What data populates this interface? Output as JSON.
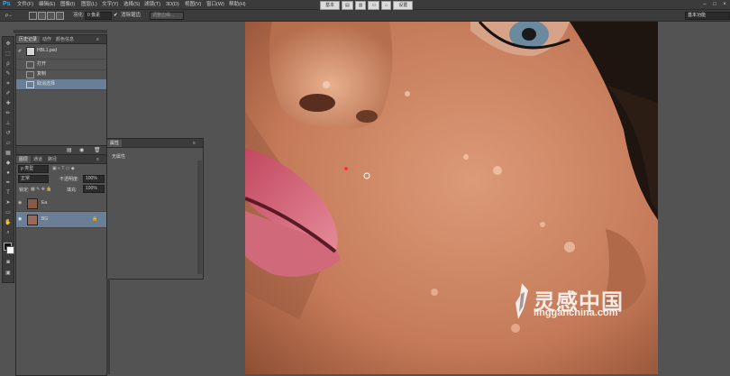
{
  "app": {
    "logo": "Ps"
  },
  "menu": [
    "文件(F)",
    "编辑(E)",
    "图像(I)",
    "图层(L)",
    "文字(Y)",
    "选择(S)",
    "滤镜(T)",
    "3D(D)",
    "视图(V)",
    "窗口(W)",
    "帮助(H)"
  ],
  "center_buttons": {
    "left": "基本",
    "right": "设置"
  },
  "options_bar": {
    "feather_label": "羽化:",
    "feather_value": "0 像素",
    "antialias_label": "消除锯齿",
    "refine_edge": "调整边缘..."
  },
  "workspace": "基本功能",
  "history_panel": {
    "tabs": [
      "历史记录",
      "动作",
      "颜色信息"
    ],
    "snapshot": "HBL1.psd",
    "items": [
      "打开",
      "复制",
      "取消选择"
    ],
    "selected_index": 2
  },
  "layers_panel": {
    "tabs": [
      "图层",
      "通道",
      "路径"
    ],
    "filter": "ρ 类型",
    "blend_mode": "正常",
    "opacity_label": "不透明度:",
    "opacity_value": "100%",
    "lock_label": "锁定:",
    "fill_label": "填充:",
    "fill_value": "100%",
    "layers": [
      {
        "name": "Ea",
        "selected": false
      },
      {
        "name": "BG",
        "selected": true
      }
    ]
  },
  "properties_panel": {
    "tab": "属性",
    "content": "无属性"
  },
  "watermark": {
    "zh": "灵感中国",
    "en": "lingganchina.com"
  },
  "colors": {
    "accent": "#31a8ff",
    "selection": "#6a7e96",
    "panel": "#535353",
    "chrome": "#3b3b3b"
  }
}
